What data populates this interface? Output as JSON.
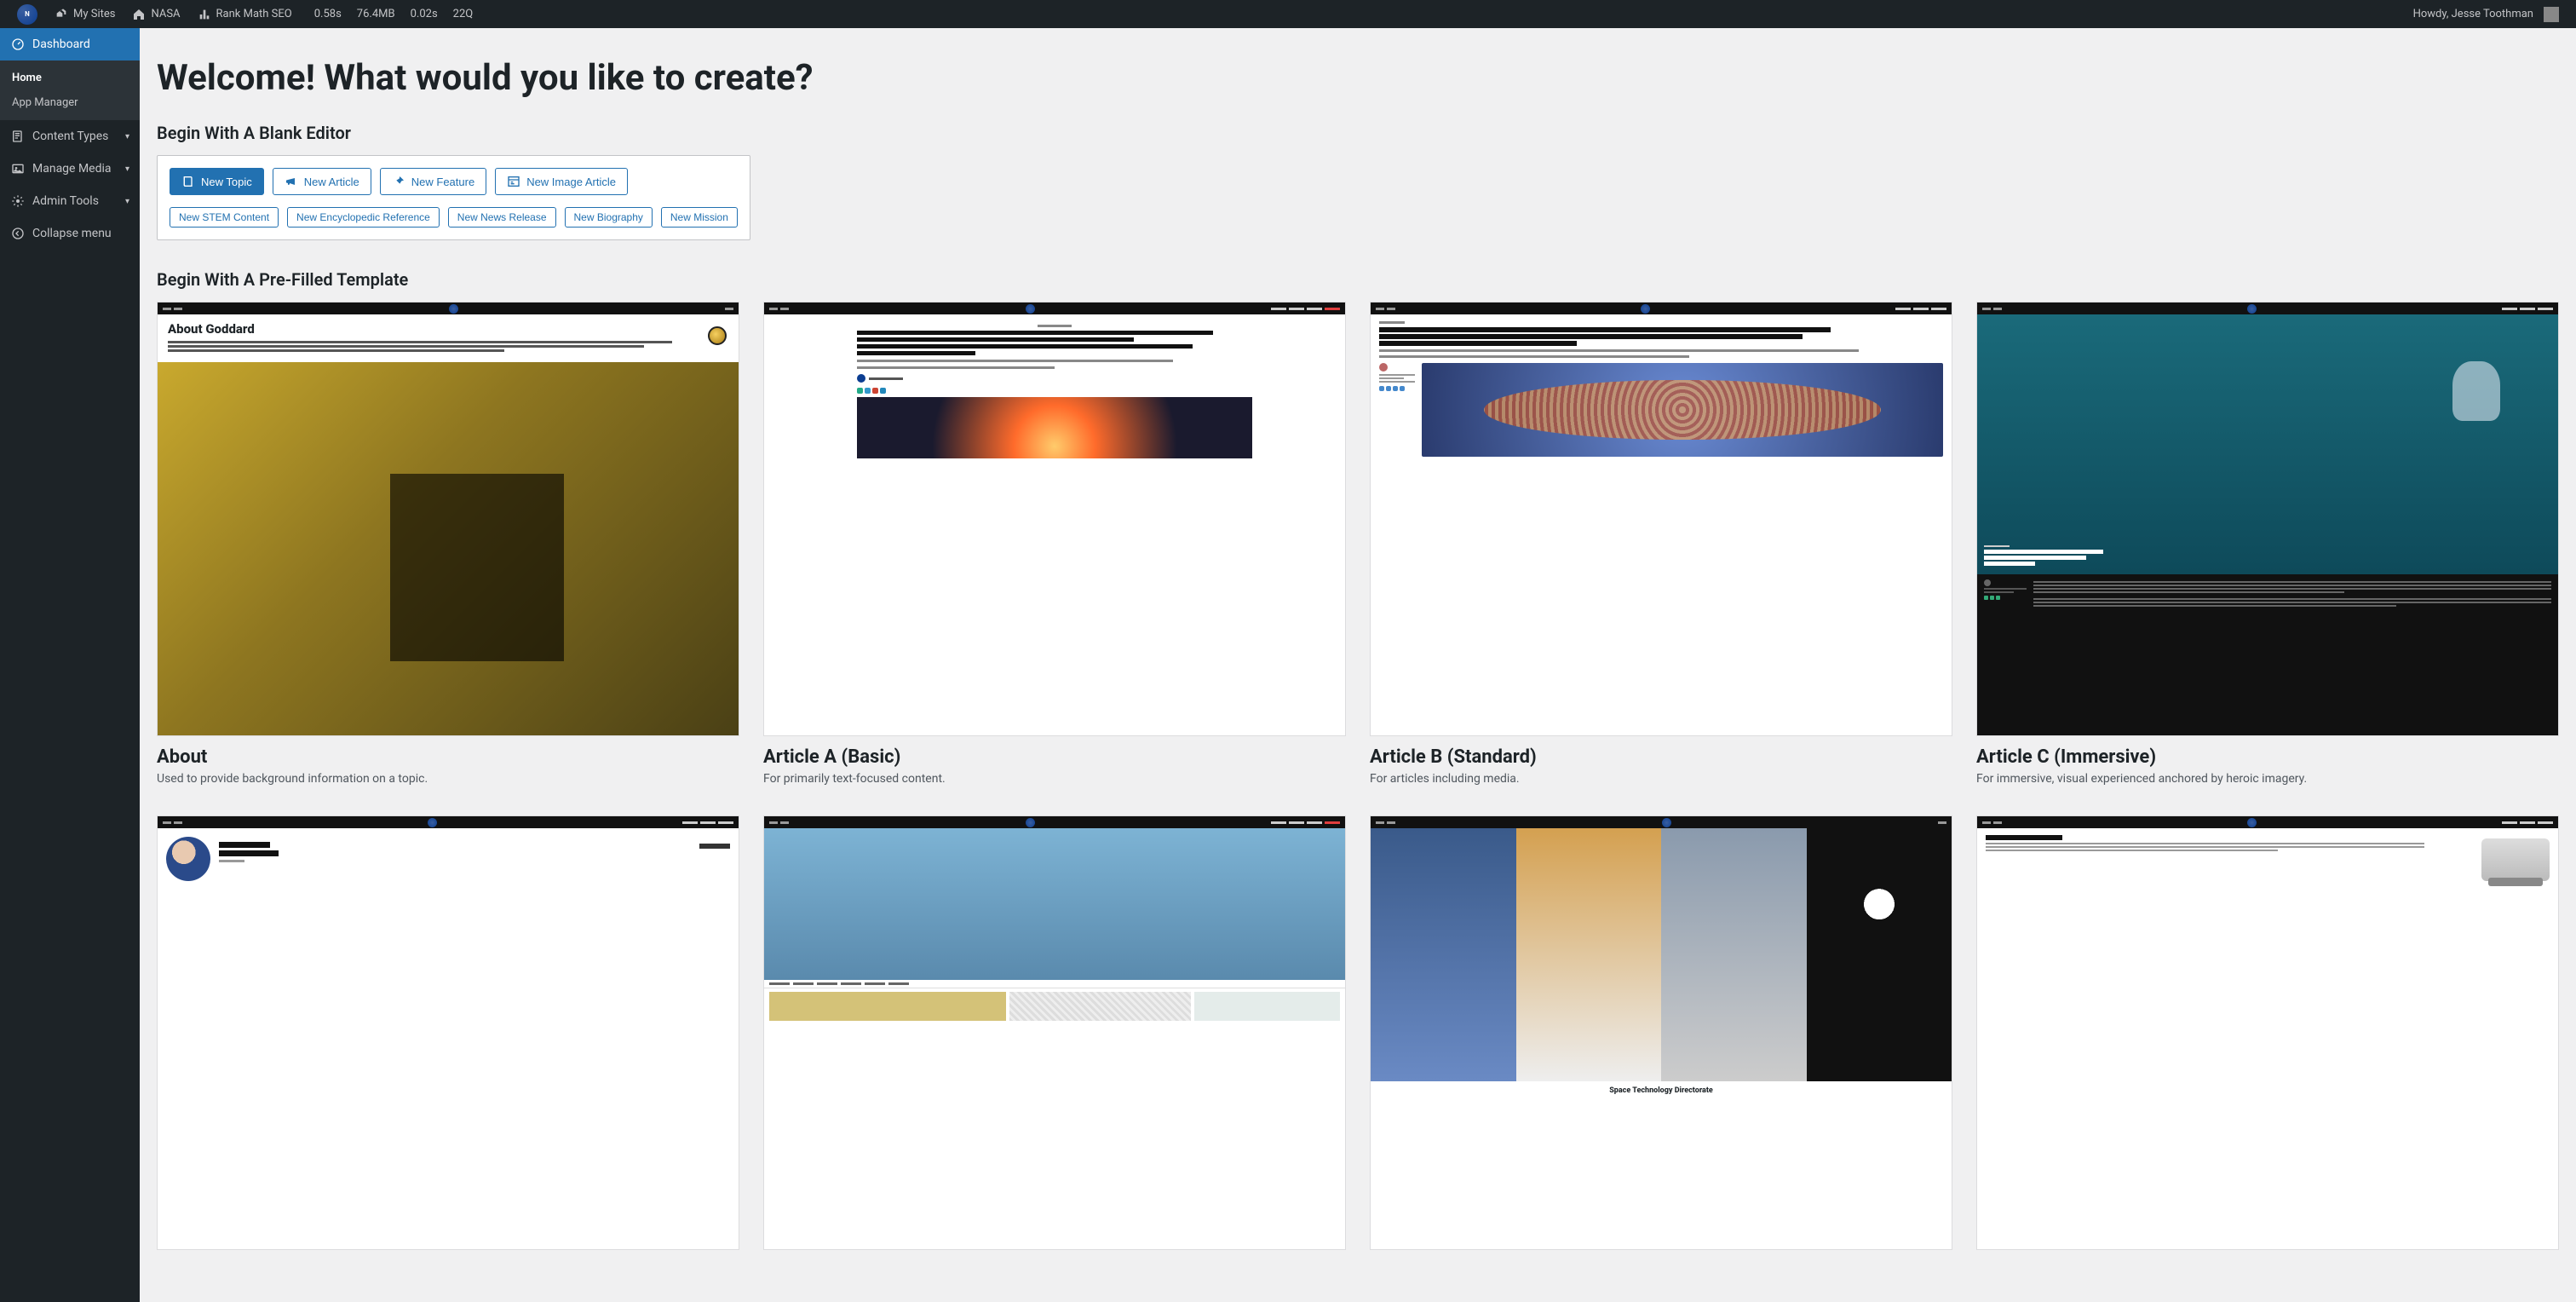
{
  "adminbar": {
    "my_sites": "My Sites",
    "site_name": "NASA",
    "rank_math": "Rank Math SEO",
    "stats": {
      "time1": "0.58s",
      "mem": "76.4MB",
      "time2": "0.02s",
      "queries": "22Q"
    },
    "howdy": "Howdy, Jesse Toothman"
  },
  "sidebar": {
    "dashboard": "Dashboard",
    "sub": {
      "home": "Home",
      "app_manager": "App Manager"
    },
    "content_types": "Content Types",
    "manage_media": "Manage Media",
    "admin_tools": "Admin Tools",
    "collapse": "Collapse menu"
  },
  "page": {
    "title": "Welcome! What would you like to create?",
    "blank_heading": "Begin With A Blank Editor",
    "template_heading": "Begin With A Pre-Filled Template"
  },
  "buttons": {
    "primary": [
      {
        "label": "New Topic"
      },
      {
        "label": "New Article"
      },
      {
        "label": "New Feature"
      },
      {
        "label": "New Image Article"
      }
    ],
    "secondary": [
      {
        "label": "New STEM Content"
      },
      {
        "label": "New Encyclopedic Reference"
      },
      {
        "label": "New News Release"
      },
      {
        "label": "New Biography"
      },
      {
        "label": "New Mission"
      }
    ]
  },
  "templates": [
    {
      "title": "About",
      "desc": "Used to provide background information on a topic."
    },
    {
      "title": "Article A (Basic)",
      "desc": "For primarily text-focused content."
    },
    {
      "title": "Article B (Standard)",
      "desc": "For articles including media."
    },
    {
      "title": "Article C (Immersive)",
      "desc": "For immersive, visual experienced anchored by heroic imagery."
    }
  ],
  "template_mock": {
    "about_title": "About Goddard",
    "dir_title": "Space Technology Directorate"
  }
}
